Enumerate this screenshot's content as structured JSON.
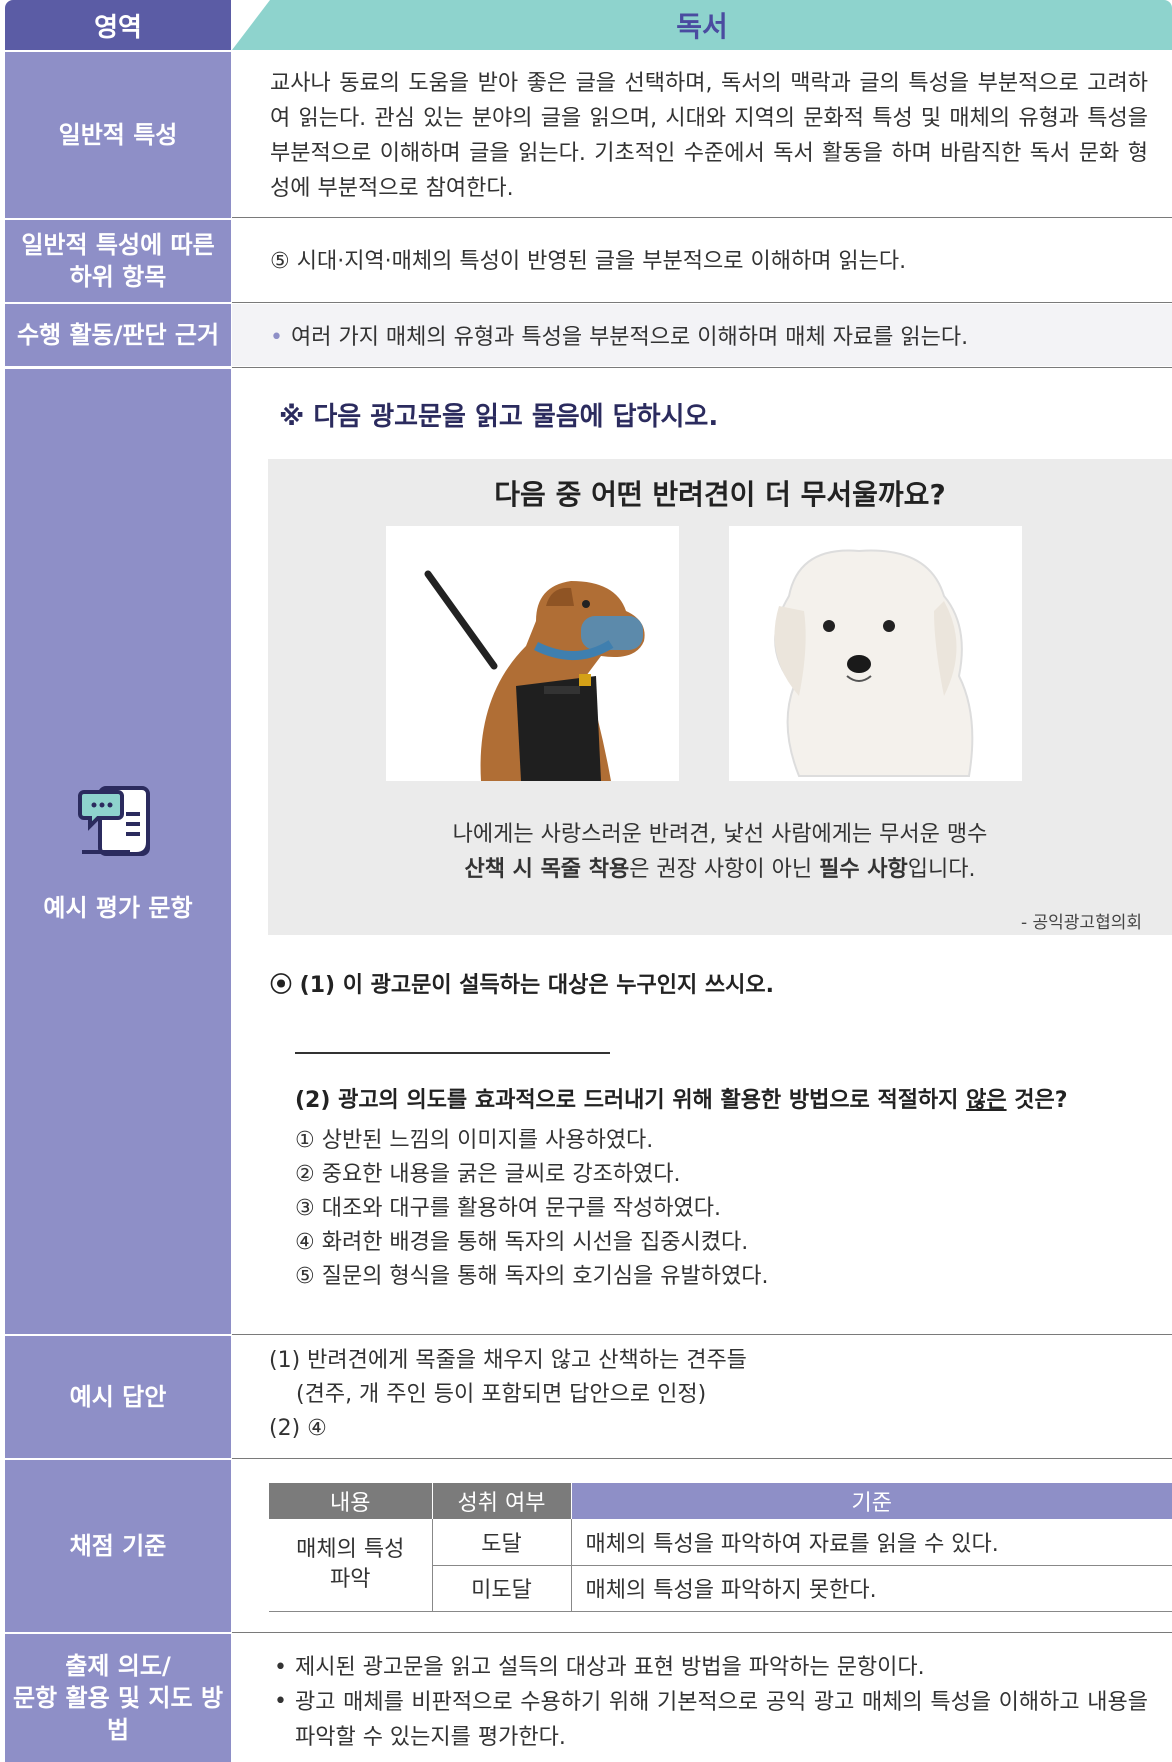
{
  "header": {
    "left": "영역",
    "right": "독서"
  },
  "rows": {
    "general": {
      "label": "일반적 특성",
      "text": "교사나 동료의 도움을 받아 좋은 글을 선택하며, 독서의 맥락과 글의 특성을 부분적으로 고려하여 읽는다. 관심 있는 분야의 글을 읽으며, 시대와 지역의 문화적 특성 및 매체의 유형과 특성을 부분적으로 이해하며 글을 읽는다. 기초적인 수준에서 독서 활동을 하며 바람직한 독서 문화 형성에 부분적으로 참여한다."
    },
    "sub": {
      "label_line1": "일반적 특성에 따른",
      "label_line2": "하위 항목",
      "text": "⑤ 시대·지역·매체의 특성이 반영된 글을 부분적으로 이해하며 읽는다."
    },
    "basis": {
      "label": "수행 활동/판단 근거",
      "bullet": "•",
      "text": "여러 가지 매체의 유형과 특성을 부분적으로 이해하며 매체 자료를 읽는다."
    },
    "example": {
      "label": "예시 평가 문항",
      "icon": "document-chat-icon",
      "instruction": "※ 다음 광고문을 읽고 물음에 답하시오.",
      "ad": {
        "title": "다음 중 어떤 반려견이 더 무서울까요?",
        "line1": "나에게는 사랑스러운 반려견, 낯선 사람에게는 무서운 맹수",
        "line2_bold1": "산책 시 목줄 착용",
        "line2_mid": "은 권장 사항이 아닌 ",
        "line2_bold2": "필수 사항",
        "line2_end": "입니다.",
        "credit": "- 공익광고협의회",
        "photo_left": "muzzled-dog-on-leash",
        "photo_right": "white-maltese-puppy"
      },
      "q1": "⦿ (1) 이 광고문이 설득하는 대상은 누구인지 쓰시오.",
      "q2_prefix": "(2) 광고의 의도를 효과적으로 드러내기 위해 활용한 방법으로 적절하지 ",
      "q2_under": "않은",
      "q2_suffix": " 것은?",
      "options": [
        "① 상반된 느낌의 이미지를 사용하였다.",
        "② 중요한 내용을 굵은 글씨로 강조하였다.",
        "③ 대조와 대구를 활용하여 문구를 작성하였다.",
        "④ 화려한 배경을 통해 독자의 시선을 집중시켰다.",
        "⑤ 질문의 형식을 통해 독자의 호기심을 유발하였다."
      ]
    },
    "answer": {
      "label": "예시 답안",
      "line1": "(1) 반려견에게 목줄을 채우지 않고 산책하는 견주들",
      "line2": "(견주, 개 주인 등이 포함되면 답안으로 인정)",
      "line3": "(2) ④"
    },
    "scoring": {
      "label": "채점 기준",
      "headers": [
        "내용",
        "성취 여부",
        "기준"
      ],
      "content_line1": "매체의 특성",
      "content_line2": "파악",
      "rows": [
        {
          "status": "도달",
          "criterion": "매체의 특성을 파악하여 자료를 읽을 수 있다."
        },
        {
          "status": "미도달",
          "criterion": "매체의 특성을 파악하지 못한다."
        }
      ]
    },
    "intent": {
      "label_line1": "출제 의도/",
      "label_line2": "문항 활용 및 지도 방법",
      "bullet": "•",
      "items": [
        "제시된 광고문을 읽고 설득의 대상과 표현 방법을 파악하는 문항이다.",
        "광고 매체를 비판적으로 수용하기 위해 기본적으로 공익 광고 매체의 특성을 이해하고 내용을 파악할 수 있는지를 평가한다."
      ]
    }
  },
  "colors": {
    "label_bg": "#8e8fc7",
    "header_left": "#5b5ca5",
    "header_right": "#8ed3cd",
    "table_head_dark": "#7b7b7b",
    "table_head_purple": "#8e8fc7"
  }
}
